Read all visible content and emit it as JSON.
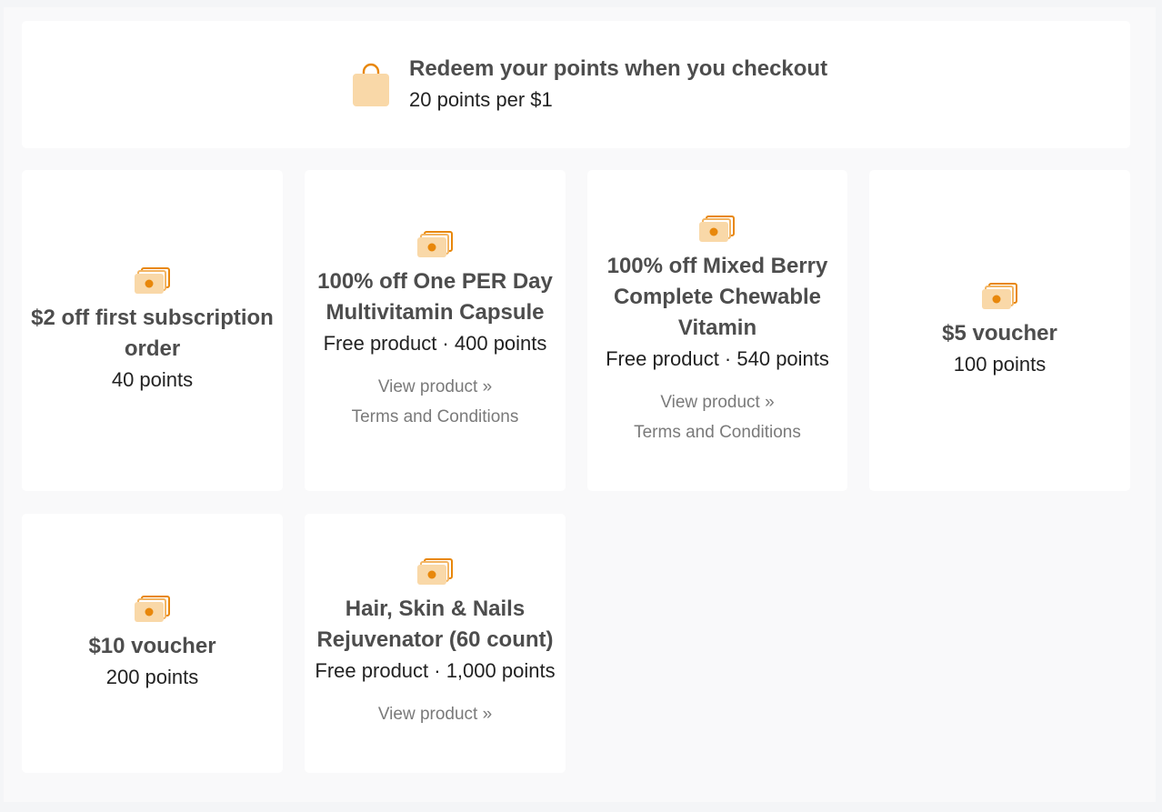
{
  "banner": {
    "icon": "shopping-bag-icon",
    "title": "Redeem your points when you checkout",
    "subtitle": "20 points per $1"
  },
  "rewards": [
    {
      "icon": "cash-icon",
      "title": "$2 off first subscription order",
      "detail": "40 points"
    },
    {
      "icon": "cash-icon",
      "title": "100% off One PER Day Multivitamin Capsule",
      "detail": "Free product · 400 points",
      "view_link": "View product »",
      "terms_link": "Terms and Conditions"
    },
    {
      "icon": "cash-icon",
      "title": "100% off Mixed Berry Complete Chewable Vitamin",
      "detail": "Free product · 540 points",
      "view_link": "View product »",
      "terms_link": "Terms and Conditions"
    },
    {
      "icon": "cash-icon",
      "title": "$5 voucher",
      "detail": "100 points"
    },
    {
      "icon": "cash-icon",
      "title": "$10 voucher",
      "detail": "200 points"
    },
    {
      "icon": "cash-icon",
      "title": "Hair, Skin & Nails Rejuvenator (60 count)",
      "detail": "Free product · 1,000 points",
      "view_link": "View product »"
    }
  ],
  "colors": {
    "accent": "#e8870a",
    "icon_light": "#f9d8a8",
    "card": "#ffffff",
    "background": "#f9f9fa"
  }
}
